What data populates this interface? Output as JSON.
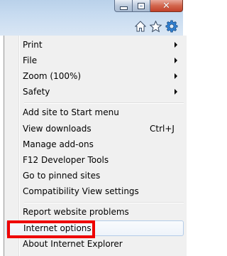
{
  "window_controls": {
    "minimize_icon": "minimize-icon",
    "maximize_icon": "maximize-icon",
    "close_icon": "close-icon"
  },
  "command_bar": {
    "home_icon": "home-icon",
    "favorites_icon": "star-icon",
    "tools_icon": "gear-icon"
  },
  "menu": {
    "items": [
      {
        "label": "Print",
        "submenu": true
      },
      {
        "label": "File",
        "submenu": true
      },
      {
        "label": "Zoom (100%)",
        "submenu": true
      },
      {
        "label": "Safety",
        "submenu": true
      },
      {
        "label": "Add site to Start menu"
      },
      {
        "label": "View downloads",
        "shortcut": "Ctrl+J"
      },
      {
        "label": "Manage add-ons"
      },
      {
        "label": "F12 Developer Tools"
      },
      {
        "label": "Go to pinned sites"
      },
      {
        "label": "Compatibility View settings"
      },
      {
        "label": "Report website problems"
      },
      {
        "label": "Internet options",
        "highlighted": true
      },
      {
        "label": "About Internet Explorer"
      }
    ]
  },
  "colors": {
    "highlight_box": "#ee0000",
    "close_button": "#c2412a",
    "tools_icon": "#2f7fd0"
  }
}
